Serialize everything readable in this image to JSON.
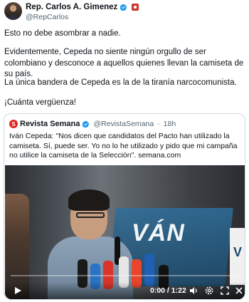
{
  "tweet": {
    "author_name": "Rep. Carlos A. Gimenez",
    "author_handle": "@RepCarlos",
    "paragraphs": [
      "Esto no debe asombrar a nadie.",
      "Evidentemente, Cepeda no siente ningún orgullo de ser colombiano y desconoce a aquellos quienes llevan la camiseta de su país.",
      "La única bandera de Cepeda es la de la tiranía narcocomunista.",
      "¡Cuánta vergüenza!"
    ]
  },
  "quoted": {
    "source_name": "Revista Semana",
    "source_handle": "@RevistaSemana",
    "separator": "·",
    "age": "18h",
    "logo_letter": "S",
    "text": "Iván Cepeda: \"Nos dicen que candidatos del Pacto han utilizado la camiseta. Sí, puede ser. Yo no lo he utilizado y pido que mi campaña no utilice la camiseta de la Selección\". semana.com"
  },
  "video": {
    "banner_text": "VÁN",
    "time": "0:00 / 1:22",
    "progress_fraction": 0
  },
  "colors": {
    "verified_blue": "#1d9bf0",
    "semana_red": "#e0241b",
    "muted_text": "#536471"
  },
  "icons": [
    "verified-icon",
    "flag-badge-icon",
    "play-icon",
    "volume-icon",
    "settings-icon",
    "fullscreen-icon",
    "close-icon"
  ]
}
